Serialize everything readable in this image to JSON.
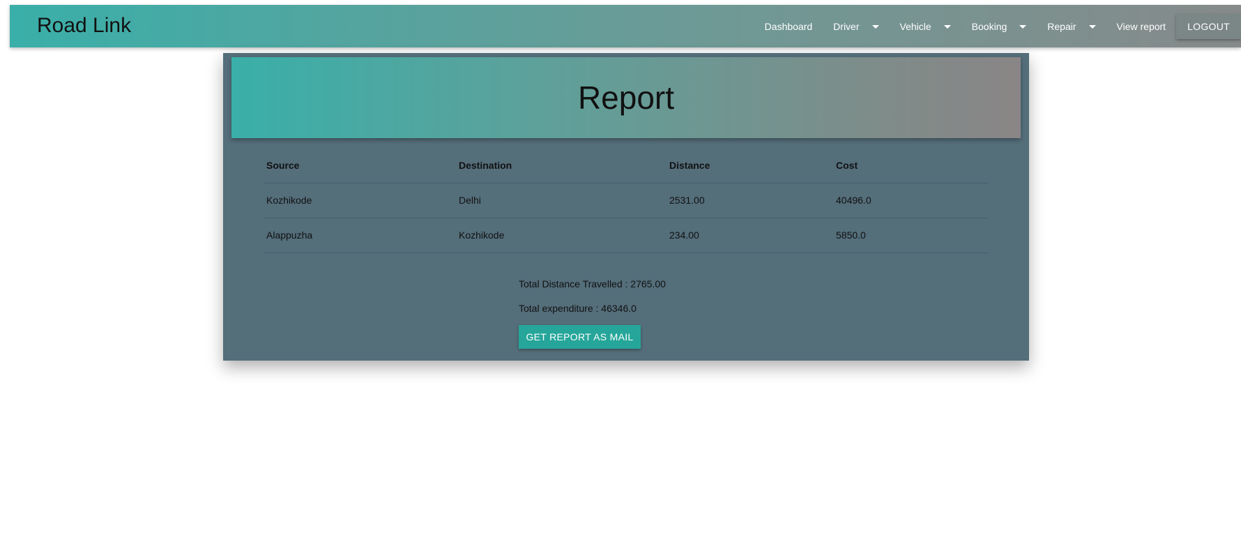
{
  "navbar": {
    "brand": "Road Link",
    "items": [
      {
        "label": "Dashboard",
        "dropdown": false
      },
      {
        "label": "Driver",
        "dropdown": true
      },
      {
        "label": "Vehicle",
        "dropdown": true
      },
      {
        "label": "Booking",
        "dropdown": true
      },
      {
        "label": "Repair",
        "dropdown": true
      },
      {
        "label": "View report",
        "dropdown": false
      }
    ],
    "logout_label": "LOGOUT"
  },
  "report": {
    "title": "Report",
    "columns": [
      "Source",
      "Destination",
      "Distance",
      "Cost"
    ],
    "rows": [
      [
        "Kozhikode",
        "Delhi",
        "2531.00",
        "40496.0"
      ],
      [
        "Alappuzha",
        "Kozhikode",
        "234.00",
        "5850.0"
      ]
    ],
    "total_distance": "Total Distance Travelled : 2765.00",
    "total_expenditure": "Total expenditure : 46346.0",
    "mail_button_label": "GET REPORT AS MAIL"
  },
  "colors": {
    "accent": "#26a69a",
    "card_bg": "#546e7a",
    "nav_gradient_start": "#3aafa9",
    "nav_gradient_end": "#868a8a"
  },
  "icons": {
    "dropdown": "caret-down-icon"
  }
}
